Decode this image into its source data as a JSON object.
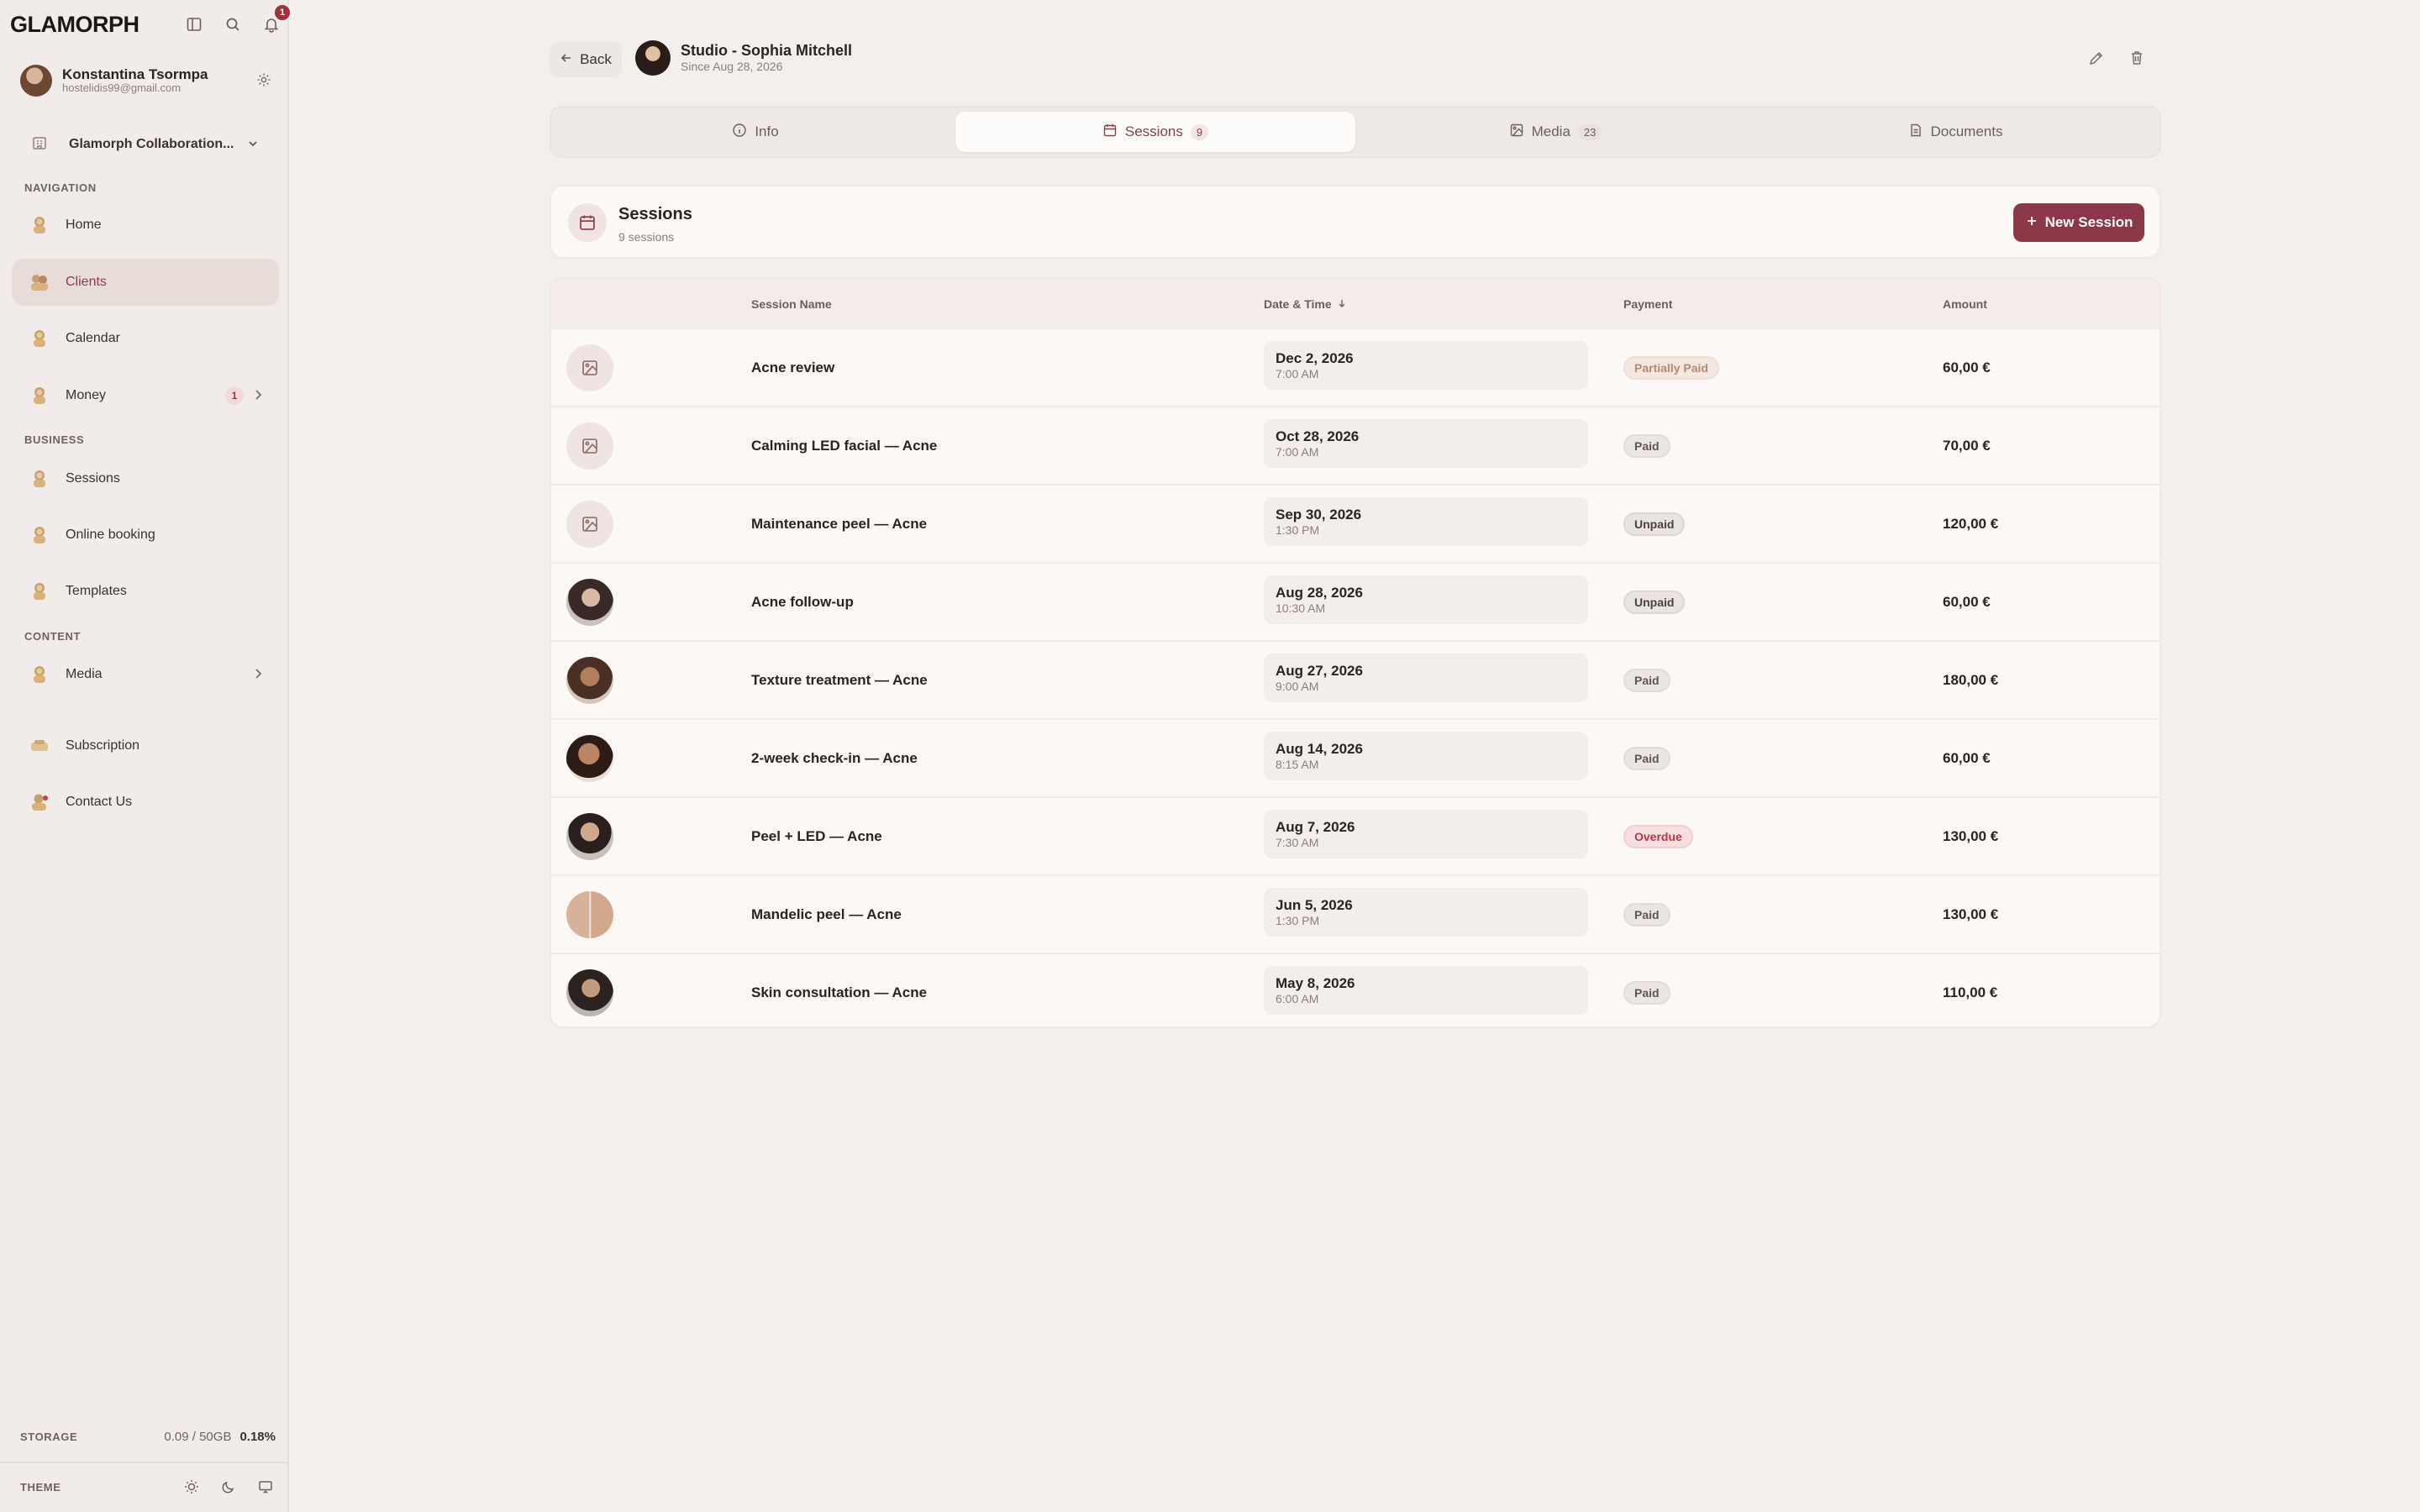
{
  "app": {
    "logo": "GLAMORPH",
    "notification_count": "1"
  },
  "user": {
    "name": "Konstantina Tsormpa",
    "email": "hostelidis99@gmail.com"
  },
  "workspace": {
    "name": "Glamorph Collaboration..."
  },
  "nav": {
    "section_navigation": "NAVIGATION",
    "section_business": "BUSINESS",
    "section_content": "CONTENT",
    "home": "Home",
    "clients": "Clients",
    "calendar": "Calendar",
    "money": "Money",
    "money_badge": "1",
    "sessions": "Sessions",
    "online_booking": "Online booking",
    "templates": "Templates",
    "media": "Media",
    "subscription": "Subscription",
    "contact_us": "Contact Us"
  },
  "storage": {
    "label": "STORAGE",
    "value": "0.09 / 50GB",
    "percent": "0.18%"
  },
  "theme": {
    "label": "THEME"
  },
  "header": {
    "back_label": "Back",
    "client_name": "Studio - Sophia Mitchell",
    "client_since": "Since Aug 28, 2026"
  },
  "tabs": [
    {
      "label": "Info",
      "count": ""
    },
    {
      "label": "Sessions",
      "count": "9"
    },
    {
      "label": "Media",
      "count": "23"
    },
    {
      "label": "Documents",
      "count": ""
    }
  ],
  "sessions_card": {
    "title": "Sessions",
    "subtitle": "9 sessions",
    "new_button": "New Session"
  },
  "table": {
    "headers": {
      "name": "Session Name",
      "date": "Date & Time",
      "payment": "Payment",
      "amount": "Amount"
    },
    "rows": [
      {
        "name": "Acne review",
        "date": "Dec 2, 2026",
        "time": "7:00 AM",
        "payment": "Partially Paid",
        "amount": "60,00 €"
      },
      {
        "name": "Calming LED facial — Acne",
        "date": "Oct 28, 2026",
        "time": "7:00 AM",
        "payment": "Paid",
        "amount": "70,00 €"
      },
      {
        "name": "Maintenance peel — Acne",
        "date": "Sep 30, 2026",
        "time": "1:30 PM",
        "payment": "Unpaid",
        "amount": "120,00 €"
      },
      {
        "name": "Acne follow-up",
        "date": "Aug 28, 2026",
        "time": "10:30 AM",
        "payment": "Unpaid",
        "amount": "60,00 €"
      },
      {
        "name": "Texture treatment — Acne",
        "date": "Aug 27, 2026",
        "time": "9:00 AM",
        "payment": "Paid",
        "amount": "180,00 €"
      },
      {
        "name": "2-week check-in — Acne",
        "date": "Aug 14, 2026",
        "time": "8:15 AM",
        "payment": "Paid",
        "amount": "60,00 €"
      },
      {
        "name": "Peel + LED — Acne",
        "date": "Aug 7, 2026",
        "time": "7:30 AM",
        "payment": "Overdue",
        "amount": "130,00 €"
      },
      {
        "name": "Mandelic peel — Acne",
        "date": "Jun 5, 2026",
        "time": "1:30 PM",
        "payment": "Paid",
        "amount": "130,00 €"
      },
      {
        "name": "Skin consultation — Acne",
        "date": "May 8, 2026",
        "time": "6:00 AM",
        "payment": "Paid",
        "amount": "110,00 €"
      }
    ]
  },
  "colors": {
    "accent": "#8b3949",
    "background": "#f3efec",
    "overdue": "#b33a4a"
  }
}
